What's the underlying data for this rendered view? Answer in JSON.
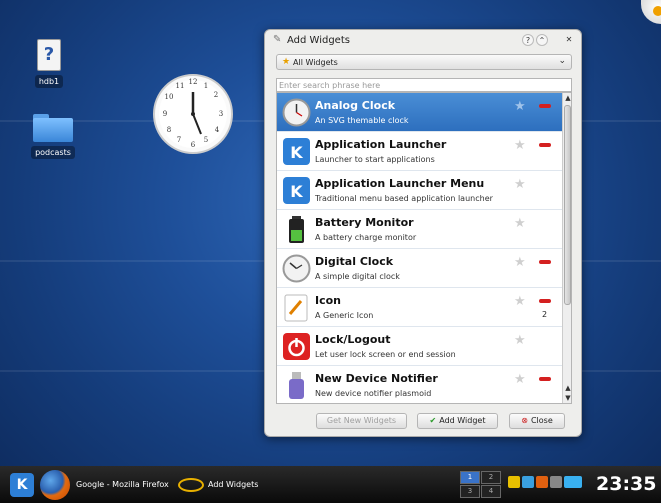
{
  "desktop": {
    "icons": [
      {
        "label": "hdb1"
      },
      {
        "label": "podcasts"
      }
    ]
  },
  "dialog": {
    "title": "Add Widgets",
    "help": "?",
    "filter": "All Widgets",
    "search_placeholder": "Enter search phrase here",
    "widgets": [
      {
        "name": "Analog Clock",
        "desc": "An SVG themable clock",
        "selected": true,
        "removable": true
      },
      {
        "name": "Application Launcher",
        "desc": "Launcher to start applications",
        "removable": true
      },
      {
        "name": "Application Launcher Menu",
        "desc": "Traditional menu based application launcher",
        "removable": false
      },
      {
        "name": "Battery Monitor",
        "desc": "A battery charge monitor",
        "removable": false
      },
      {
        "name": "Digital Clock",
        "desc": "A simple digital clock",
        "removable": true
      },
      {
        "name": "Icon",
        "desc": "A Generic Icon",
        "removable": true,
        "count": "2"
      },
      {
        "name": "Lock/Logout",
        "desc": "Let user lock screen or end session",
        "removable": false
      },
      {
        "name": "New Device Notifier",
        "desc": "New device notifier plasmoid",
        "removable": true
      }
    ],
    "buttons": {
      "get_new": "Get New Widgets",
      "add": "Add Widget",
      "close": "Close"
    }
  },
  "taskbar": {
    "tasks": [
      {
        "label": "Google - Mozilla Firefox"
      },
      {
        "label": "Add Widgets"
      }
    ],
    "pager": [
      "1",
      "2",
      "3",
      "4"
    ],
    "clock": "23:35"
  },
  "colors": {
    "selection": "#3b7fcc",
    "remove": "#d42020",
    "accent": "#2d7fd6"
  }
}
